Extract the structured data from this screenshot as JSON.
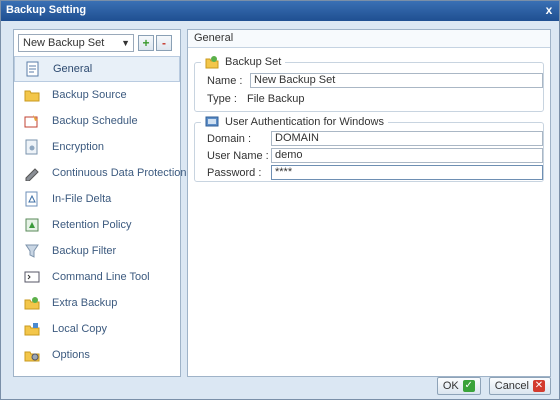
{
  "window": {
    "title": "Backup Setting",
    "close_glyph": "x"
  },
  "backup_set_selector": {
    "value": "New Backup Set",
    "add_glyph": "+",
    "remove_glyph": "-"
  },
  "nav": [
    {
      "label": "General",
      "icon": "general-icon"
    },
    {
      "label": "Backup Source",
      "icon": "folder-icon"
    },
    {
      "label": "Backup Schedule",
      "icon": "schedule-icon"
    },
    {
      "label": "Encryption",
      "icon": "encryption-icon"
    },
    {
      "label": "Continuous Data Protection",
      "icon": "cdp-icon"
    },
    {
      "label": "In-File Delta",
      "icon": "delta-icon"
    },
    {
      "label": "Retention Policy",
      "icon": "retention-icon"
    },
    {
      "label": "Backup Filter",
      "icon": "filter-icon"
    },
    {
      "label": "Command Line Tool",
      "icon": "terminal-icon"
    },
    {
      "label": "Extra Backup",
      "icon": "extra-backup-icon"
    },
    {
      "label": "Local Copy",
      "icon": "local-copy-icon"
    },
    {
      "label": "Options",
      "icon": "options-icon"
    }
  ],
  "selected_nav": "General",
  "panel": {
    "heading": "General",
    "backup_set": {
      "title": "Backup Set",
      "name_label": "Name :",
      "name_value": "New Backup Set",
      "type_label": "Type :",
      "type_value": "File Backup"
    },
    "auth": {
      "title": "User Authentication for Windows",
      "domain_label": "Domain :",
      "domain_value": "DOMAIN",
      "user_label": "User Name :",
      "user_value": "demo",
      "password_label": "Password :",
      "password_value": "****"
    }
  },
  "buttons": {
    "ok": "OK",
    "cancel": "Cancel"
  },
  "colors": {
    "title_bar": "#2a5fa3",
    "ok_icon": "#3aa33a",
    "cancel_icon": "#d33b2e",
    "nav_text": "#3c5a7f"
  }
}
